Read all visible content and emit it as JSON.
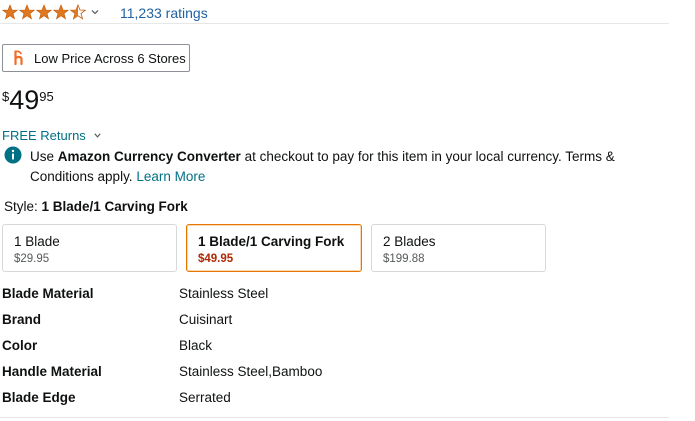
{
  "rating": {
    "stars": 4.5,
    "count_label": "11,233 ratings"
  },
  "low_price": {
    "label": "Low Price Across 6 Stores"
  },
  "price": {
    "currency": "$",
    "whole": "49",
    "fraction": "95"
  },
  "returns": {
    "label": "FREE Returns"
  },
  "currency_note": {
    "pre": "Use ",
    "bold": "Amazon Currency Converter",
    "post": " at checkout to pay for this item in your local currency. Terms & Conditions apply. ",
    "link": "Learn More"
  },
  "style": {
    "label": "Style: ",
    "selected": "1 Blade/1 Carving Fork",
    "options": [
      {
        "name": "1 Blade",
        "price": "$29.95"
      },
      {
        "name": "1 Blade/1 Carving Fork",
        "price": "$49.95"
      },
      {
        "name": "2 Blades",
        "price": "$199.88"
      }
    ]
  },
  "specs": [
    {
      "key": "Blade Material",
      "value": "Stainless Steel"
    },
    {
      "key": "Brand",
      "value": "Cuisinart"
    },
    {
      "key": "Color",
      "value": "Black"
    },
    {
      "key": "Handle Material",
      "value": "Stainless Steel,Bamboo"
    },
    {
      "key": "Blade Edge",
      "value": "Serrated"
    }
  ],
  "colors": {
    "star": "#de7921",
    "link": "#007185",
    "selected_border": "#e77600",
    "price_red": "#b12704"
  },
  "icons": {
    "star": "star-icon",
    "half_star": "half-star-icon",
    "chevron": "chevron-down-icon",
    "honey": "honey-logo-icon",
    "info": "info-icon"
  }
}
